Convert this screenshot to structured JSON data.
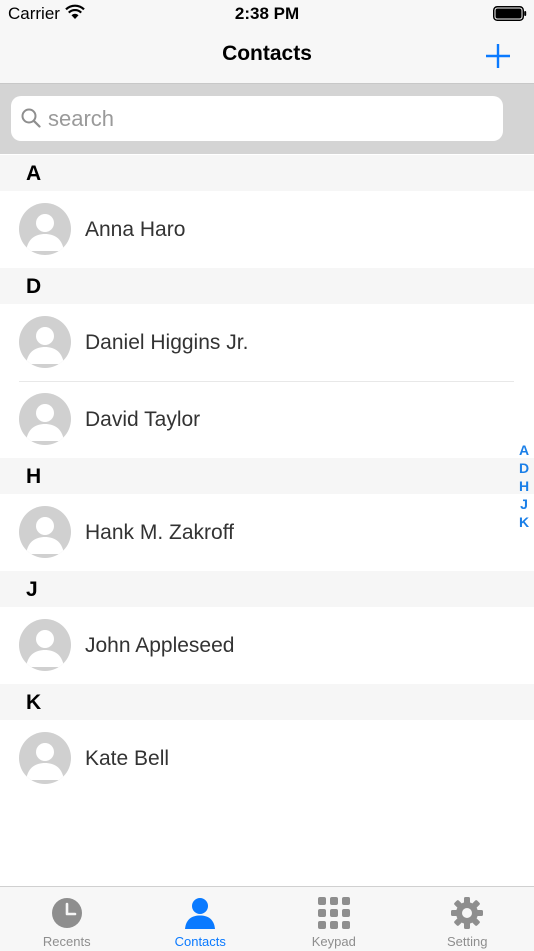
{
  "status_bar": {
    "carrier": "Carrier",
    "time": "2:38 PM"
  },
  "nav": {
    "title": "Contacts",
    "add_icon": "plus-icon"
  },
  "search": {
    "placeholder": "search"
  },
  "sections": [
    {
      "letter": "A",
      "contacts": [
        "Anna Haro"
      ]
    },
    {
      "letter": "D",
      "contacts": [
        "Daniel Higgins Jr.",
        "David Taylor"
      ]
    },
    {
      "letter": "H",
      "contacts": [
        "Hank M. Zakroff"
      ]
    },
    {
      "letter": "J",
      "contacts": [
        "John Appleseed"
      ]
    },
    {
      "letter": "K",
      "contacts": [
        "Kate Bell"
      ]
    }
  ],
  "index_letters": [
    "A",
    "D",
    "H",
    "J",
    "K"
  ],
  "tabs": [
    {
      "label": "Recents",
      "icon": "clock-icon",
      "active": false
    },
    {
      "label": "Contacts",
      "icon": "person-icon",
      "active": true
    },
    {
      "label": "Keypad",
      "icon": "keypad-icon",
      "active": false
    },
    {
      "label": "Setting",
      "icon": "gear-icon",
      "active": false
    }
  ],
  "colors": {
    "accent": "#0a7aff",
    "index": "#1a7fe8",
    "inactive_tab": "#8e8e8e",
    "avatar": "#d0d0d0"
  }
}
